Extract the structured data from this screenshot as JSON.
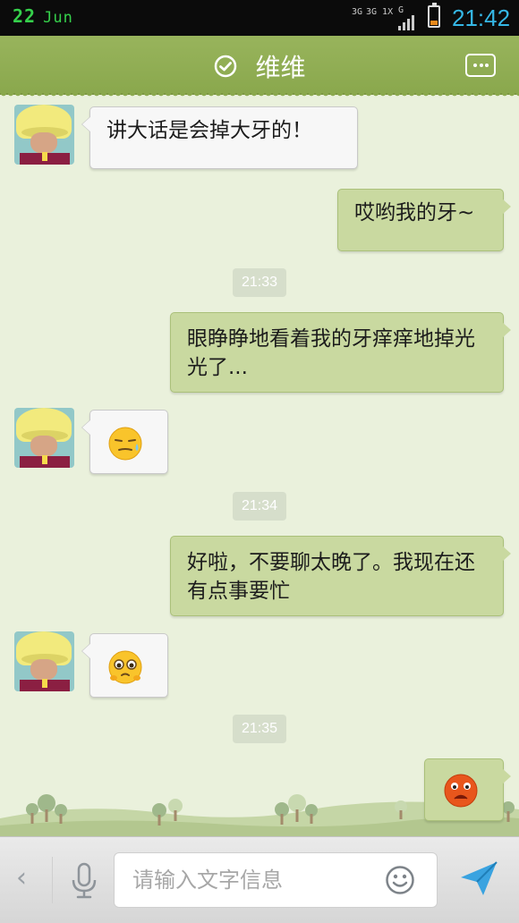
{
  "status_bar": {
    "date_day": "22",
    "date_month": "Jun",
    "network_1": "3G",
    "network_2": "3G 1X",
    "network_3": "G",
    "battery_level": 0.25,
    "time": "21:42"
  },
  "header": {
    "title": "维维",
    "verified_icon": "check-circle-icon",
    "more_icon": "more-dots-icon"
  },
  "messages": [
    {
      "side": "in",
      "text": "讲大话是会掉大牙的！"
    },
    {
      "side": "out",
      "text": "哎哟我的牙~"
    },
    {
      "type": "timestamp",
      "text": "21:33"
    },
    {
      "side": "out",
      "text": "眼睁睁地看着我的牙痒痒地掉光光了..."
    },
    {
      "side": "in",
      "emoji": "sweat-face-icon"
    },
    {
      "type": "timestamp",
      "text": "21:34"
    },
    {
      "side": "out",
      "text": "好啦，不要聊太晚了。我现在还有点事要忙"
    },
    {
      "side": "in",
      "emoji": "teary-eyed-face-icon"
    },
    {
      "type": "timestamp",
      "text": "21:35"
    },
    {
      "side": "out",
      "emoji": "angry-red-face-icon"
    }
  ],
  "input_bar": {
    "back_icon": "chevron-left-icon",
    "mic_icon": "microphone-icon",
    "placeholder": "请输入文字信息",
    "emoji_icon": "smiley-icon",
    "send_icon": "send-icon"
  },
  "colors": {
    "header": "#8aa84d",
    "chat_background": "#eaf1dc",
    "outgoing_bubble": "#c9d9a0",
    "incoming_bubble": "#f7f7f7",
    "clock": "#35b7e5",
    "date": "#35d04b"
  }
}
